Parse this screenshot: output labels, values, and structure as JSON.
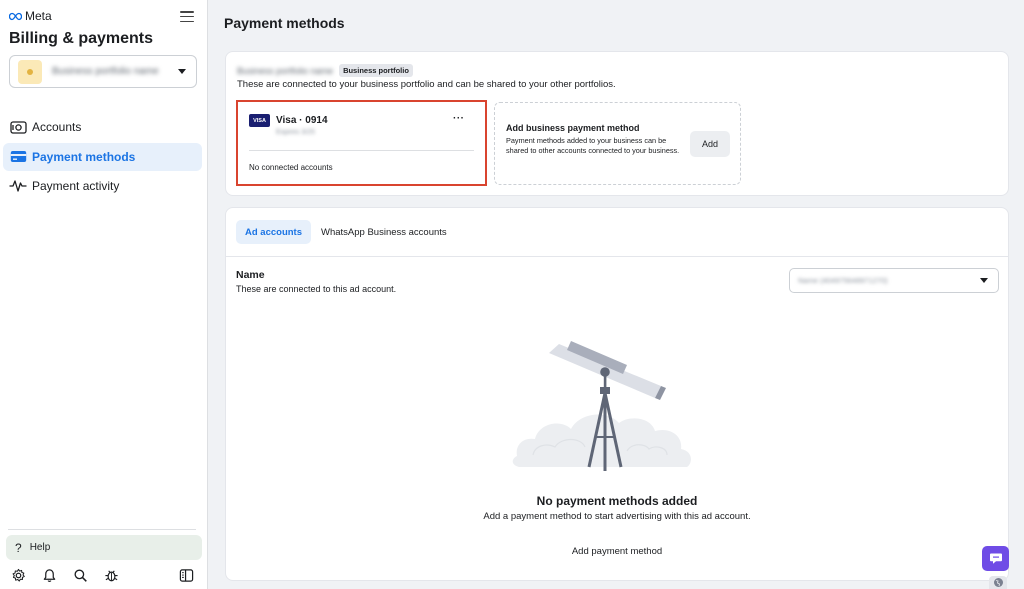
{
  "brand": {
    "name": "Meta"
  },
  "app": {
    "title": "Billing & payments"
  },
  "portfolio_selector": {
    "name": "Business portfolio name"
  },
  "nav": {
    "items": [
      {
        "label": "Accounts",
        "icon": "accounts-icon",
        "active": false
      },
      {
        "label": "Payment methods",
        "icon": "credit-card-icon",
        "active": true
      },
      {
        "label": "Payment activity",
        "icon": "activity-icon",
        "active": false
      }
    ]
  },
  "help": {
    "label": "Help"
  },
  "toolbar": {
    "icons": [
      "gear-icon",
      "bell-icon",
      "search-icon",
      "bug-icon",
      "panel-toggle-icon"
    ]
  },
  "page": {
    "title": "Payment methods"
  },
  "business_portfolio": {
    "name": "Business portfolio name",
    "badge": "Business portfolio",
    "description": "These are connected to your business portfolio and can be shared to your other portfolios."
  },
  "payment_method": {
    "brand_logo": "VISA",
    "label": "Visa · 0914",
    "expiry": "Expires 3/25",
    "more_label": "···",
    "status": "No connected accounts"
  },
  "add_payment": {
    "title": "Add business payment method",
    "description": "Payment methods added to your business can be shared to other accounts connected to your business.",
    "button_label": "Add"
  },
  "tabs": [
    {
      "label": "Ad accounts",
      "active": true
    },
    {
      "label": "WhatsApp Business accounts",
      "active": false
    }
  ],
  "accounts_section": {
    "heading": "Name",
    "description": "These are connected to this ad account.",
    "selected_account": "Name (404975648971270)"
  },
  "empty_state": {
    "title": "No payment methods added",
    "description": "Add a payment method to start advertising with this ad account.",
    "action_label": "Add payment method"
  },
  "colors": {
    "accent": "#1b74e4",
    "highlight_border": "#d9442f",
    "visa_blue": "#1a1f71",
    "chat_purple": "#6f4ce6"
  }
}
